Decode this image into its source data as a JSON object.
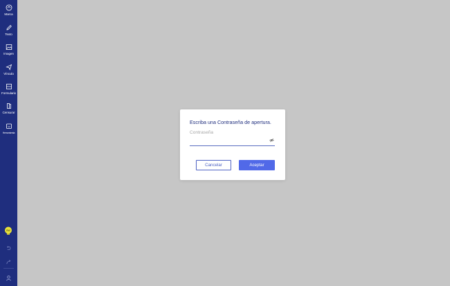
{
  "sidebar": {
    "items": [
      {
        "label": "Marca",
        "icon": "stamp-icon"
      },
      {
        "label": "Texto",
        "icon": "pencil-icon"
      },
      {
        "label": "Imagen",
        "icon": "image-icon"
      },
      {
        "label": "Vínculo",
        "icon": "send-icon"
      },
      {
        "label": "Formulario",
        "icon": "form-icon"
      },
      {
        "label": "Censurar",
        "icon": "redact-icon"
      },
      {
        "label": "Herramienta",
        "icon": "toolbox-icon"
      }
    ],
    "bulb_badge": "BW",
    "colors": {
      "background": "#1f2e7e",
      "bulb": "#e8e23a"
    }
  },
  "dialog": {
    "title": "Escriba una Contraseña de apertura.",
    "password_placeholder": "Contraseña",
    "cancel_label": "Cancelar",
    "accept_label": "Aceptar",
    "colors": {
      "accent": "#5169e8",
      "title": "#1f2e7e"
    }
  }
}
